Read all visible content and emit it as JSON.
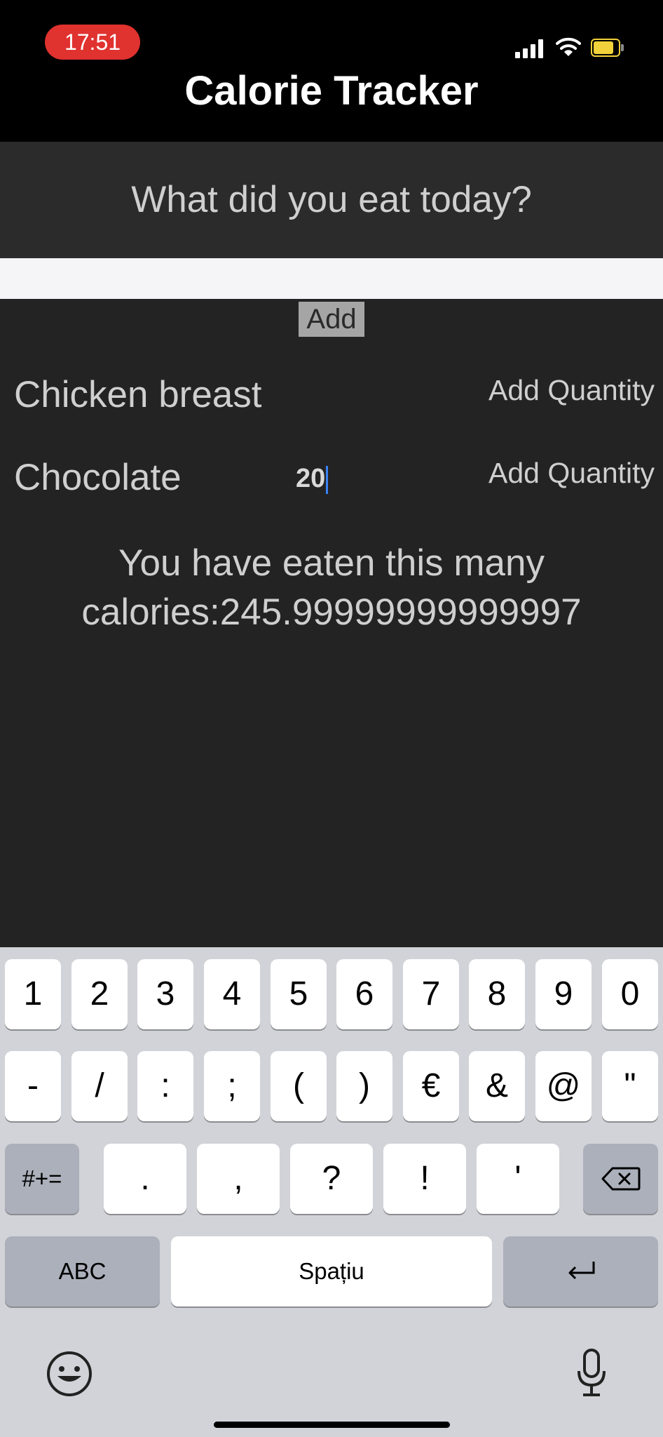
{
  "status_bar": {
    "time": "17:51",
    "signal_icon": "cellular-signal-icon",
    "wifi_icon": "wifi-icon",
    "battery_icon": "battery-icon",
    "battery_color": "#f2d23a",
    "time_pill_color": "#e0322f"
  },
  "app": {
    "title": "Calorie Tracker"
  },
  "form": {
    "prompt": "What did you eat today?",
    "food_input_value": "",
    "add_label": "Add"
  },
  "foods": [
    {
      "name": "Chicken breast",
      "quantity": "",
      "quantity_placeholder": "Add Quantity"
    },
    {
      "name": "Chocolate",
      "quantity": "20",
      "quantity_placeholder": "Add Quantity"
    }
  ],
  "result": {
    "line1": "You have eaten this many",
    "line2": "calories:245.99999999999997"
  },
  "keyboard": {
    "row1": [
      "1",
      "2",
      "3",
      "4",
      "5",
      "6",
      "7",
      "8",
      "9",
      "0"
    ],
    "row2": [
      "-",
      "/",
      ":",
      ";",
      "(",
      ")",
      "€",
      "&",
      "@",
      "\""
    ],
    "row3": [
      ".",
      ",",
      "?",
      "!",
      "'"
    ],
    "symbols_key": "#+=",
    "abc_key": "ABC",
    "space_key": "Spațiu",
    "backspace_icon": "backspace-icon",
    "return_icon": "return-icon",
    "emoji_icon": "emoji-icon",
    "mic_icon": "microphone-icon"
  }
}
